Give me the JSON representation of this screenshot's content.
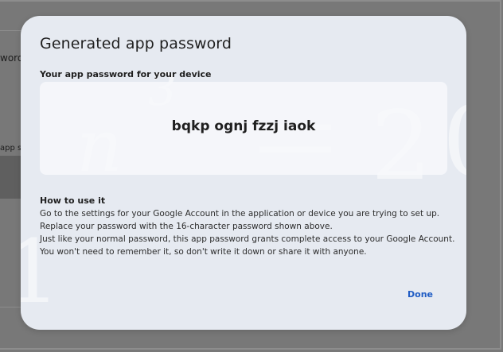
{
  "background": {
    "label_top": "word",
    "label_mid": "app sp"
  },
  "dialog": {
    "title": "Generated app password",
    "password_label": "Your app password for your device",
    "password": "bqkp ognj fzzj iaok",
    "how_to_title": "How to use it",
    "how_to_lines": [
      "Go to the settings for your Google Account in the application or device you are trying to set up.",
      "Replace your password with the 16-character password shown above.",
      "Just like your normal password, this app password grants complete access to your Google Account.",
      "You won't need to remember it, so don't write it down or share it with anyone."
    ],
    "done_label": "Done"
  },
  "colors": {
    "dialog_bg": "#e6eaf1",
    "accent": "#1f5cc4",
    "scrim": "#787878"
  }
}
